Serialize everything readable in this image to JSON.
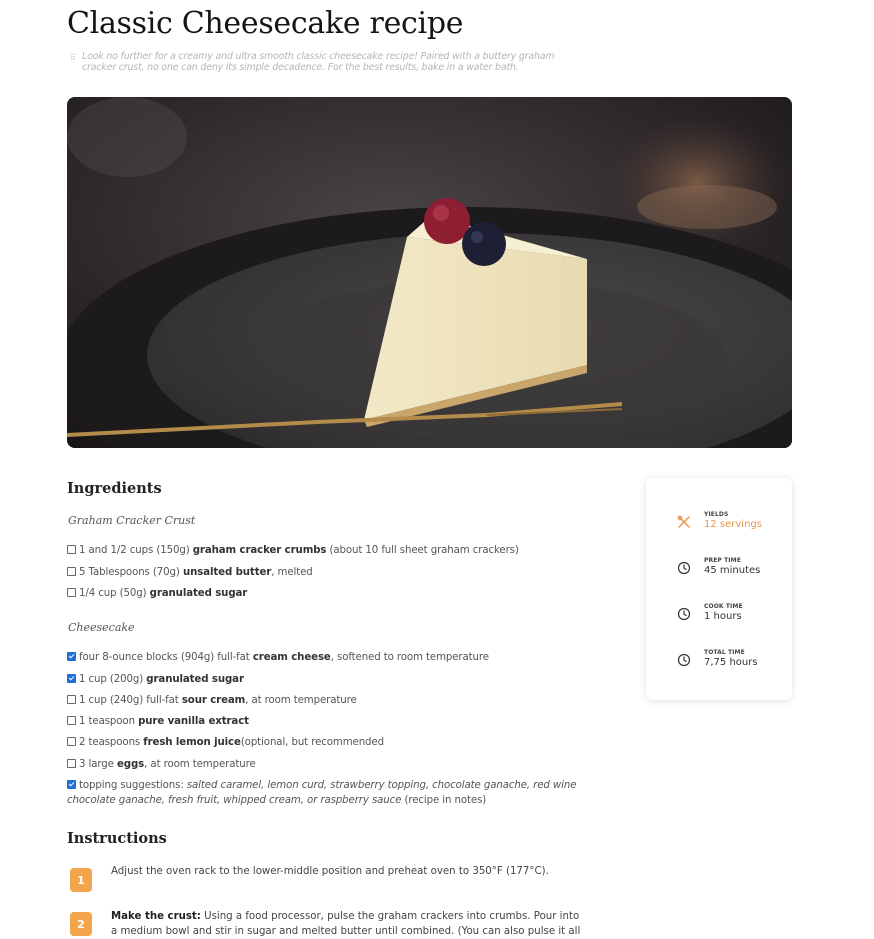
{
  "recipe": {
    "title": "Classic Cheesecake recipe",
    "description": "Look no further for a creamy and ultra smooth classic cheesecake recipe! Paired with a buttery graham cracker crust, no one can deny its simple decadence. For the best results, bake in a water bath."
  },
  "ingredients": {
    "heading": "Ingredients",
    "crust_heading": "Graham Cracker Crust",
    "cake_heading": "Cheesecake",
    "crust_items": [
      {
        "pre": "1 and 1/2 cups (150g) ",
        "bold": "graham cracker crumbs",
        "post": " (about 10 full sheet graham crackers)",
        "checked": false
      },
      {
        "pre": "5 Tablespoons (70g) ",
        "bold": "unsalted butter",
        "post": ", melted",
        "checked": false
      },
      {
        "pre": "1/4 cup (50g) ",
        "bold": "granulated sugar",
        "post": "",
        "checked": false
      }
    ],
    "cake_items": [
      {
        "pre": "four 8-ounce blocks (904g) full-fat ",
        "bold": "cream cheese",
        "post": ", softened to room temperature",
        "checked": true
      },
      {
        "pre": "1 cup (200g) ",
        "bold": "granulated sugar",
        "post": "",
        "checked": true
      },
      {
        "pre": "1 cup (240g) full-fat ",
        "bold": "sour cream",
        "post": ", at room temperature",
        "checked": false
      },
      {
        "pre": "1 teaspoon ",
        "bold": "pure vanilla extract",
        "post": "",
        "checked": false
      },
      {
        "pre": "2 teaspoons ",
        "bold": "fresh lemon juice",
        "post": "(optional, but recommended",
        "checked": false
      },
      {
        "pre": "3 large ",
        "bold": "eggs",
        "post": ", at room temperature",
        "checked": false
      }
    ],
    "topping": {
      "pre": "topping suggestions: ",
      "italic": "salted caramel, lemon curd, strawberry topping, chocolate ganache, red wine chocolate ganache, fresh fruit, whipped cream, or raspberry sauce",
      "post": " (recipe in notes)",
      "checked": true
    }
  },
  "meta": [
    {
      "label": "YIELDS",
      "value": "12 servings",
      "icon": "utensils-icon"
    },
    {
      "label": "PREP TIME",
      "value": "45 minutes",
      "icon": "clock-icon"
    },
    {
      "label": "COOK TIME",
      "value": "1 hours",
      "icon": "clock-icon"
    },
    {
      "label": "TOTAL TIME",
      "value": "7,75 hours",
      "icon": "clock-icon"
    }
  ],
  "instructions": {
    "heading": "Instructions",
    "steps": [
      {
        "num": "1",
        "bold": "",
        "text": "Adjust the oven rack to the lower-middle position and preheat oven to 350°F (177°C)."
      },
      {
        "num": "2",
        "bold": "Make the crust:",
        "text": " Using a food processor, pulse the graham crackers into crumbs. Pour into a medium bowl and stir in sugar and melted butter until combined. (You can also pulse it all"
      }
    ]
  },
  "colors": {
    "accent": "#e8984a",
    "badge": "#f2a54a",
    "checkbox": "#1e6fd9"
  }
}
